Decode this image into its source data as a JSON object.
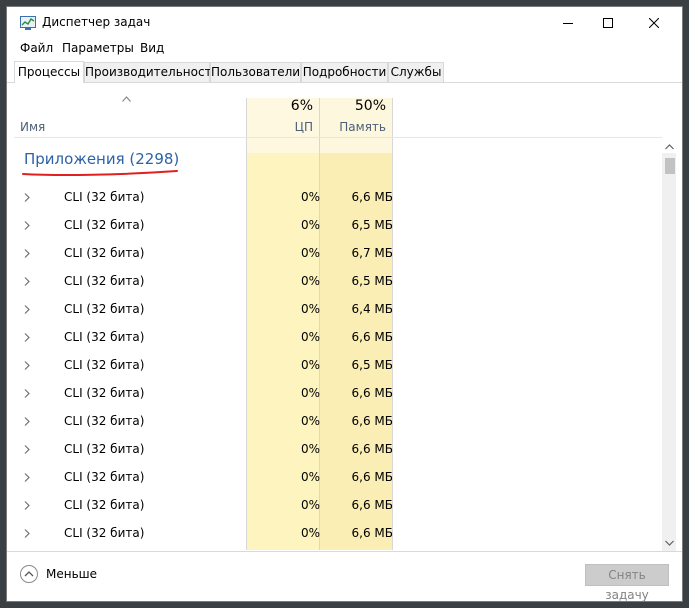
{
  "window": {
    "title": "Диспетчер задач",
    "icon": "task-manager-icon"
  },
  "menu": [
    "Файл",
    "Параметры",
    "Вид"
  ],
  "tabs": [
    {
      "label": "Процессы",
      "active": true
    },
    {
      "label": "Производительность",
      "active": false
    },
    {
      "label": "Пользователи",
      "active": false
    },
    {
      "label": "Подробности",
      "active": false
    },
    {
      "label": "Службы",
      "active": false
    }
  ],
  "columns": {
    "name": {
      "label": "Имя"
    },
    "cpu": {
      "label": "ЦП",
      "percent": "6%"
    },
    "memory": {
      "label": "Память",
      "percent": "50%"
    }
  },
  "group": {
    "title": "Приложения (2298)"
  },
  "processes": [
    {
      "name": "CLI (32 бита)",
      "cpu": "0%",
      "memory": "6,6 МБ"
    },
    {
      "name": "CLI (32 бита)",
      "cpu": "0%",
      "memory": "6,5 МБ"
    },
    {
      "name": "CLI (32 бита)",
      "cpu": "0%",
      "memory": "6,7 МБ"
    },
    {
      "name": "CLI (32 бита)",
      "cpu": "0%",
      "memory": "6,5 МБ"
    },
    {
      "name": "CLI (32 бита)",
      "cpu": "0%",
      "memory": "6,4 МБ"
    },
    {
      "name": "CLI (32 бита)",
      "cpu": "0%",
      "memory": "6,6 МБ"
    },
    {
      "name": "CLI (32 бита)",
      "cpu": "0%",
      "memory": "6,5 МБ"
    },
    {
      "name": "CLI (32 бита)",
      "cpu": "0%",
      "memory": "6,6 МБ"
    },
    {
      "name": "CLI (32 бита)",
      "cpu": "0%",
      "memory": "6,6 МБ"
    },
    {
      "name": "CLI (32 бита)",
      "cpu": "0%",
      "memory": "6,6 МБ"
    },
    {
      "name": "CLI (32 бита)",
      "cpu": "0%",
      "memory": "6,6 МБ"
    },
    {
      "name": "CLI (32 бита)",
      "cpu": "0%",
      "memory": "6,6 МБ"
    },
    {
      "name": "CLI (32 бита)",
      "cpu": "0%",
      "memory": "6,6 МБ"
    }
  ],
  "footer": {
    "less_label": "Меньше",
    "end_task_label": "Снять задачу"
  },
  "colors": {
    "cpu_column": "#fdf4bf",
    "memory_column": "#fbeeb4",
    "group_title": "#2c62a8",
    "annotation_underline": "#e02020"
  }
}
